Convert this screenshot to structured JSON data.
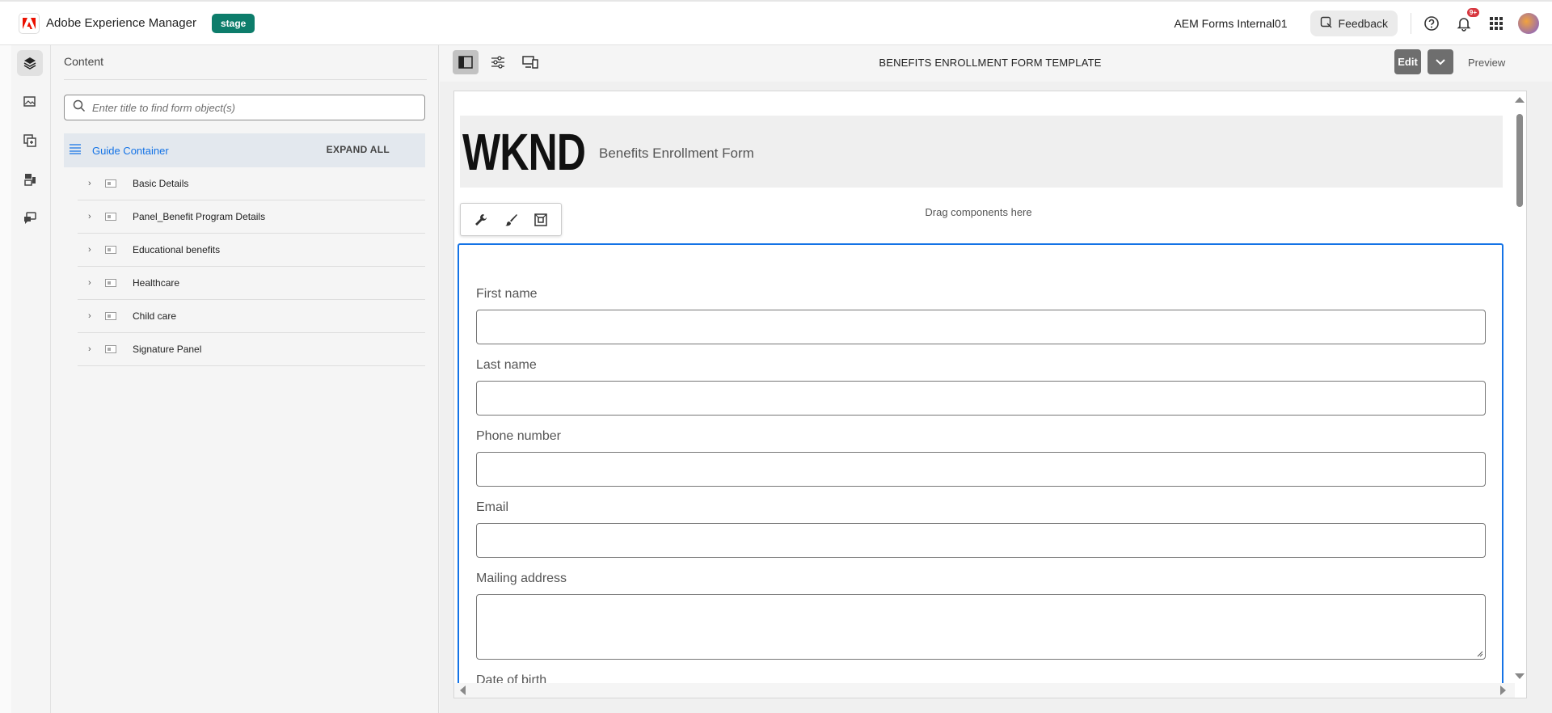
{
  "topbar": {
    "app_title": "Adobe Experience Manager",
    "env_badge": "stage",
    "org_name": "AEM Forms Internal01",
    "feedback_label": "Feedback",
    "notif_count": "9+"
  },
  "rail": {
    "items": [
      "content-tree",
      "assets",
      "components",
      "data-sources",
      "rules"
    ]
  },
  "content_panel": {
    "title": "Content",
    "search_placeholder": "Enter title to find form object(s)",
    "root_label": "Guide Container",
    "expand_all_label": "EXPAND ALL",
    "items": [
      {
        "label": "Basic Details"
      },
      {
        "label": "Panel_Benefit Program Details"
      },
      {
        "label": "Educational benefits"
      },
      {
        "label": "Healthcare"
      },
      {
        "label": "Child care"
      },
      {
        "label": "Signature Panel"
      }
    ]
  },
  "editor": {
    "form_title": "BENEFITS ENROLLMENT FORM TEMPLATE",
    "edit_label": "Edit",
    "preview_label": "Preview"
  },
  "form": {
    "logo_text": "WKND",
    "header_title": "Benefits Enrollment Form",
    "drag_hint": "Drag components here",
    "fields": [
      {
        "label": "First name",
        "value": ""
      },
      {
        "label": "Last name",
        "value": ""
      },
      {
        "label": "Phone number",
        "value": ""
      },
      {
        "label": "Email",
        "value": ""
      },
      {
        "label": "Mailing address",
        "value": ""
      },
      {
        "label": "Date of birth",
        "value": ""
      }
    ]
  },
  "colors": {
    "accent": "#1473e6",
    "badge": "#0d7d6b",
    "notif": "#d7373f"
  }
}
